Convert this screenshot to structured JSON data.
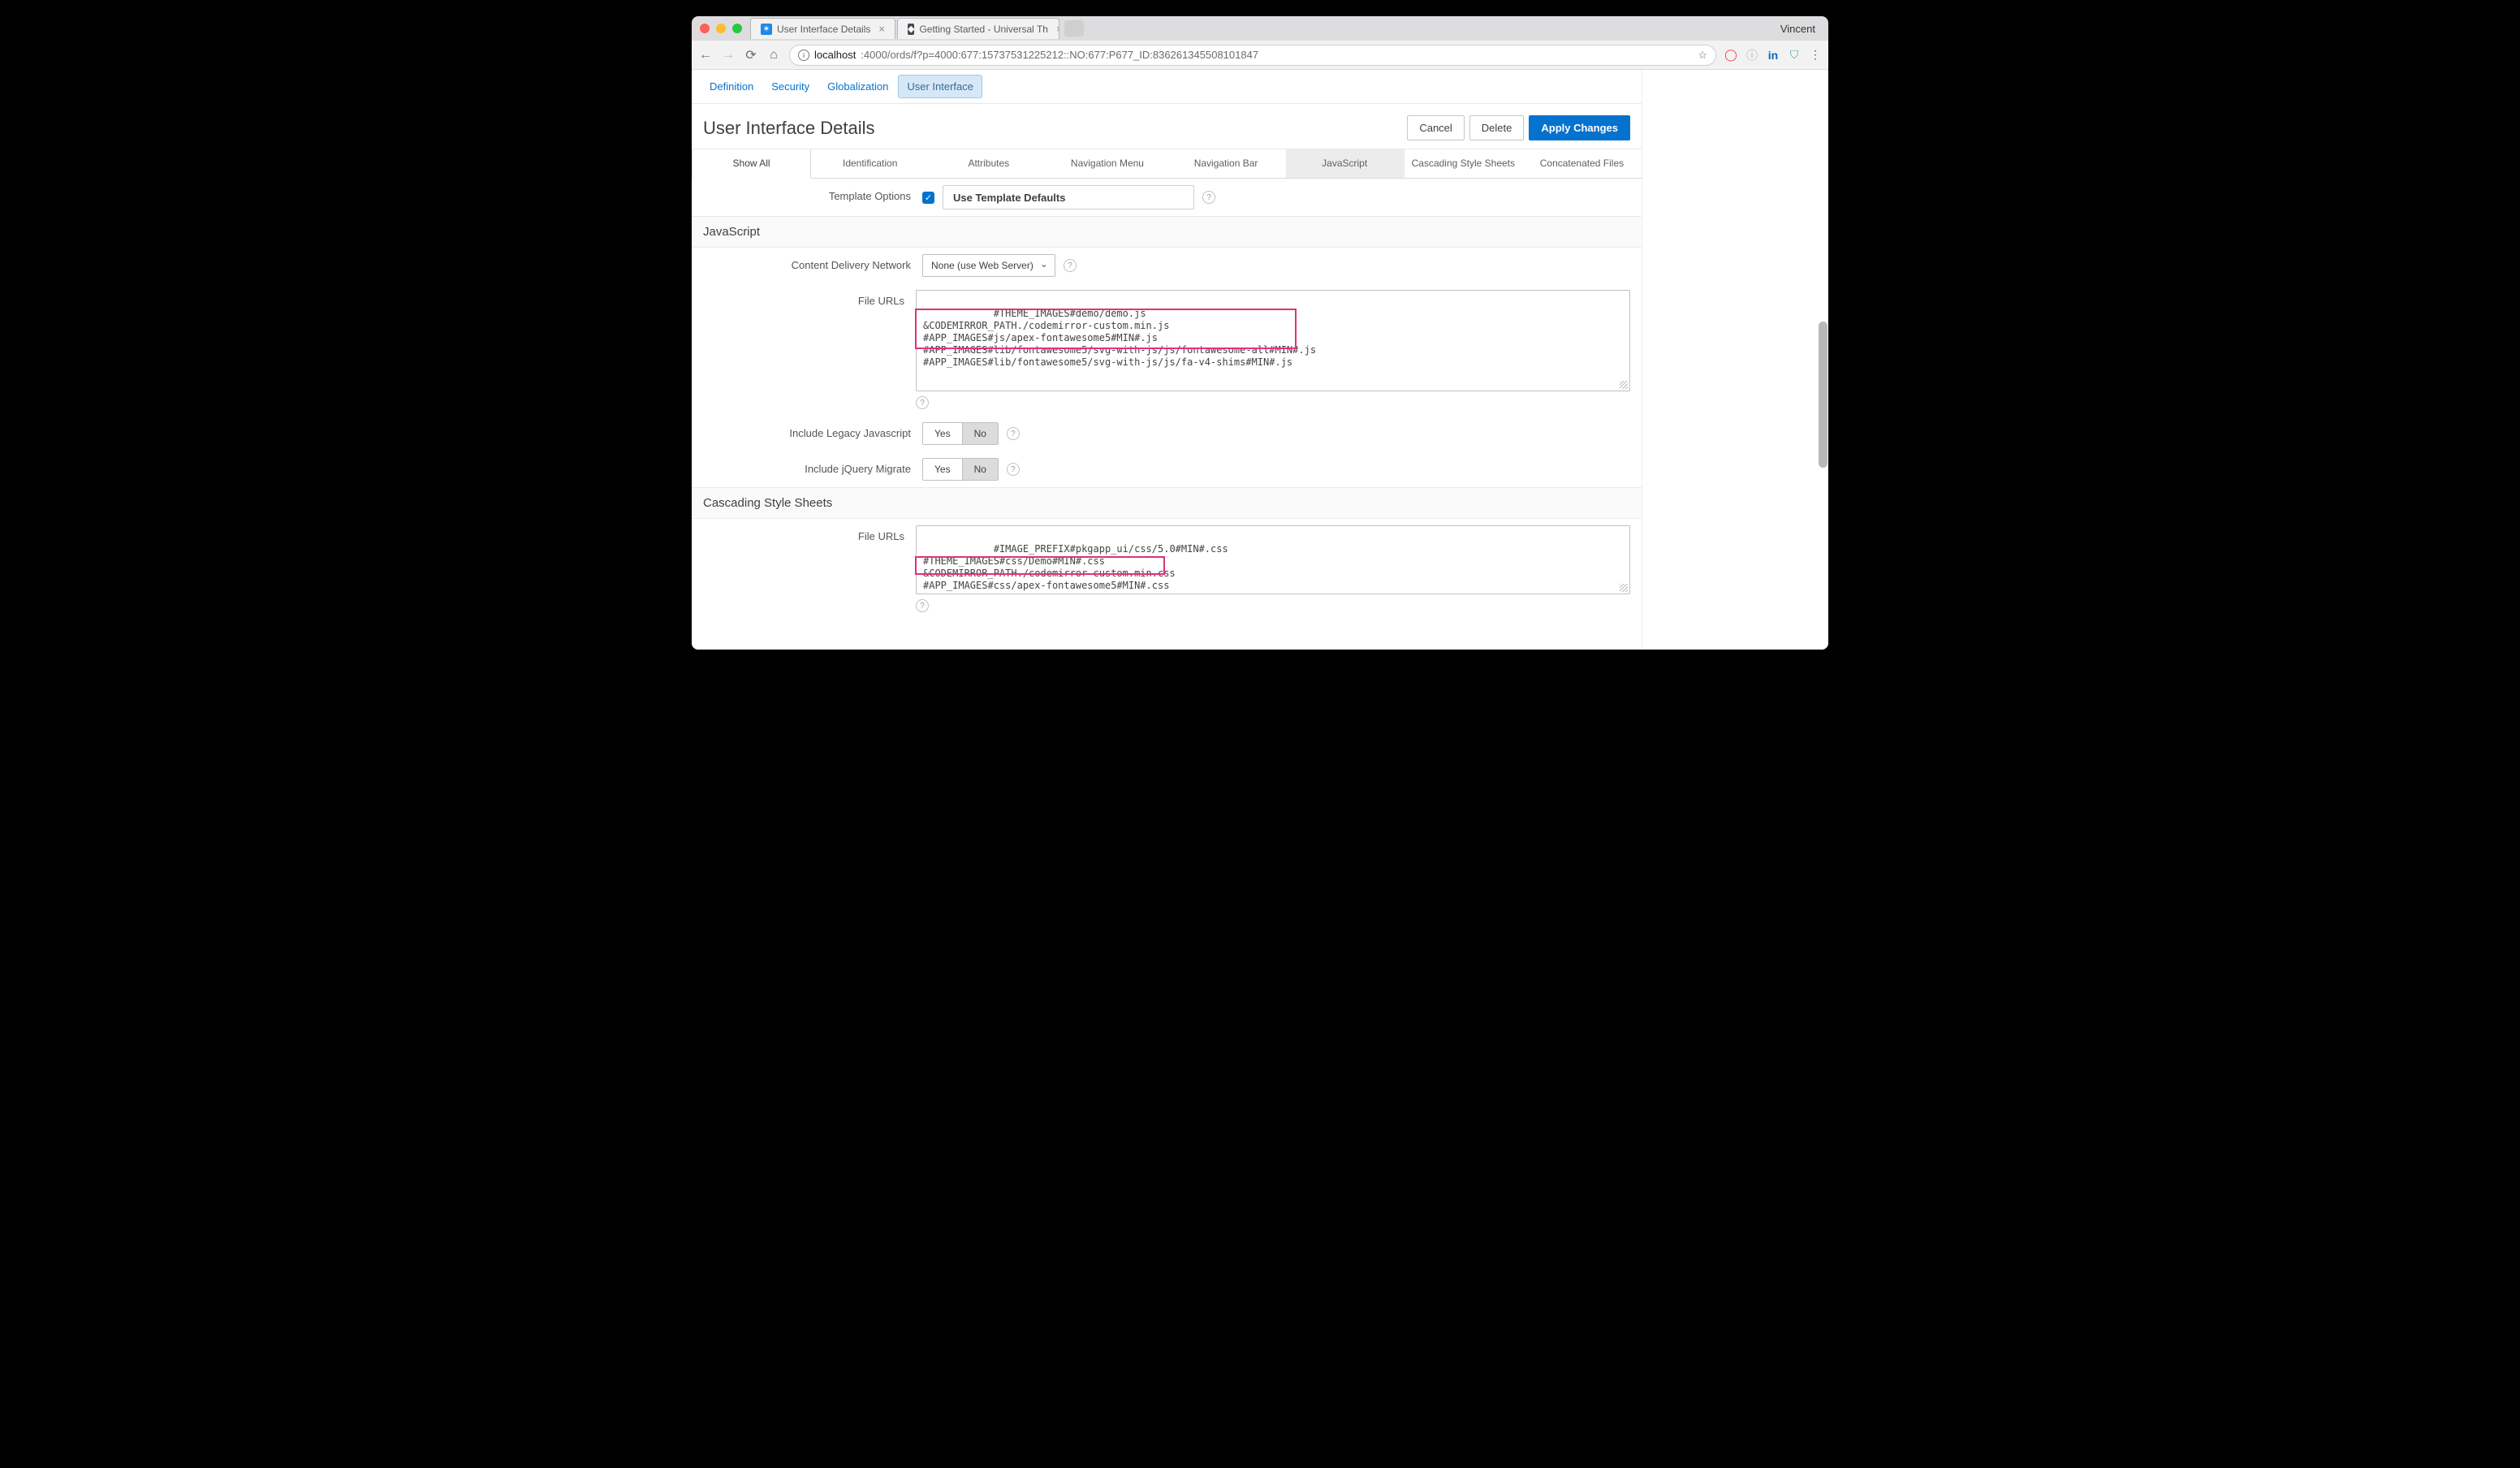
{
  "browser": {
    "tabs": [
      {
        "title": "User Interface Details",
        "favicon_bg": "#1e88e5",
        "favicon_glyph": "⚆"
      },
      {
        "title": "Getting Started - Universal Th",
        "favicon_bg": "#3b4a5a",
        "favicon_glyph": "◆"
      }
    ],
    "profile": "Vincent",
    "url_host": "localhost",
    "url_path": ":4000/ords/f?p=4000:677:15737531225212::NO:677:P677_ID:836261345508101847"
  },
  "topnav": {
    "items": [
      "Definition",
      "Security",
      "Globalization",
      "User Interface"
    ],
    "active": "User Interface"
  },
  "page": {
    "title": "User Interface Details",
    "cancel": "Cancel",
    "delete": "Delete",
    "apply": "Apply Changes"
  },
  "sections": [
    "Show All",
    "Identification",
    "Attributes",
    "Navigation Menu",
    "Navigation Bar",
    "JavaScript",
    "Cascading Style Sheets",
    "Concatenated Files"
  ],
  "templateOptions": {
    "label": "Template Options",
    "value": "Use Template Defaults"
  },
  "js_section": {
    "heading": "JavaScript",
    "cdn_label": "Content Delivery Network",
    "cdn_value": "None (use Web Server)",
    "file_urls_label": "File URLs",
    "file_urls_value": "#THEME_IMAGES#demo/demo.js\n&CODEMIRROR_PATH./codemirror-custom.min.js\n#APP_IMAGES#js/apex-fontawesome5#MIN#.js\n#APP_IMAGES#lib/fontawesome5/svg-with-js/js/fontawesome-all#MIN#.js\n#APP_IMAGES#lib/fontawesome5/svg-with-js/js/fa-v4-shims#MIN#.js",
    "legacy_label": "Include Legacy Javascript",
    "jquery_label": "Include jQuery Migrate",
    "yes": "Yes",
    "no": "No"
  },
  "css_section": {
    "heading": "Cascading Style Sheets",
    "file_urls_label": "File URLs",
    "file_urls_value": "#IMAGE_PREFIX#pkgapp_ui/css/5.0#MIN#.css\n#THEME_IMAGES#css/Demo#MIN#.css\n&CODEMIRROR_PATH./codemirror-custom.min.css\n#APP_IMAGES#css/apex-fontawesome5#MIN#.css"
  }
}
